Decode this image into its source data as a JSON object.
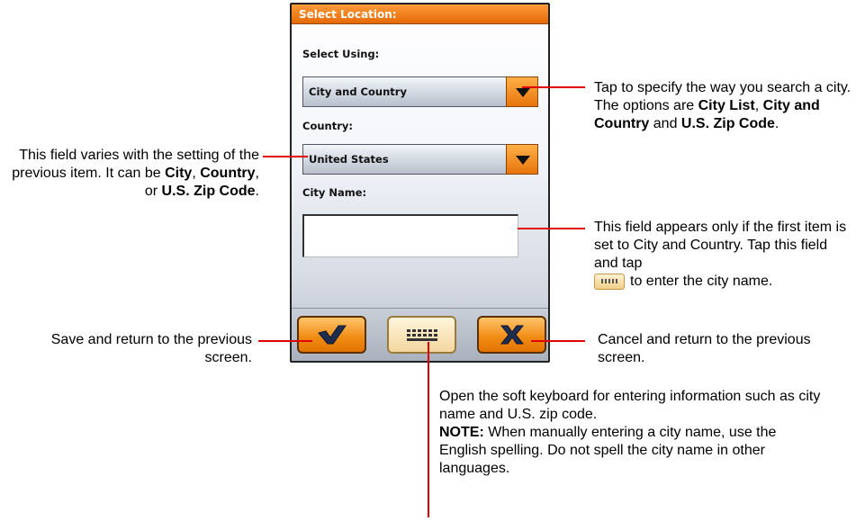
{
  "dialog": {
    "title": "Select Location:",
    "select_using_label": "Select Using:",
    "select_using_value": "City and Country",
    "country_label": "Country:",
    "country_value": "United States",
    "city_name_label": "City Name:",
    "city_name_value": ""
  },
  "buttons": {
    "ok_icon": "checkmark-icon",
    "keyboard_icon": "keyboard-icon",
    "cancel_icon": "x-icon"
  },
  "callouts": {
    "select_using": {
      "p1": "Tap to specify the way you search a city. The options are ",
      "b1": "City List",
      "p2": ", ",
      "b2": "City and Country",
      "p3": " and ",
      "b3": "U.S. Zip Code",
      "p4": "."
    },
    "country": {
      "p1": "This field varies with the setting of the previous item. It can be ",
      "b1": "City",
      "p2": ", ",
      "b2": "Country",
      "p3": ", or ",
      "b3": "U.S. Zip Code",
      "p4": "."
    },
    "city_name": {
      "p1": "This field appears only if the first item is set to City and Country. Tap this field and tap",
      "p2": "to enter the city name."
    },
    "save": "Save and return to the previous screen.",
    "cancel": "Cancel and return to the previous screen.",
    "keyboard": {
      "text": "Open the soft keyboard for entering information such as city name and U.S. zip code.",
      "note_label": "NOTE:",
      "note_text": " When manually entering a city name, use the English spelling. Do not spell the city name in other languages."
    }
  },
  "colors": {
    "accent_orange": "#f08a12",
    "callout_line": "#e00000"
  }
}
